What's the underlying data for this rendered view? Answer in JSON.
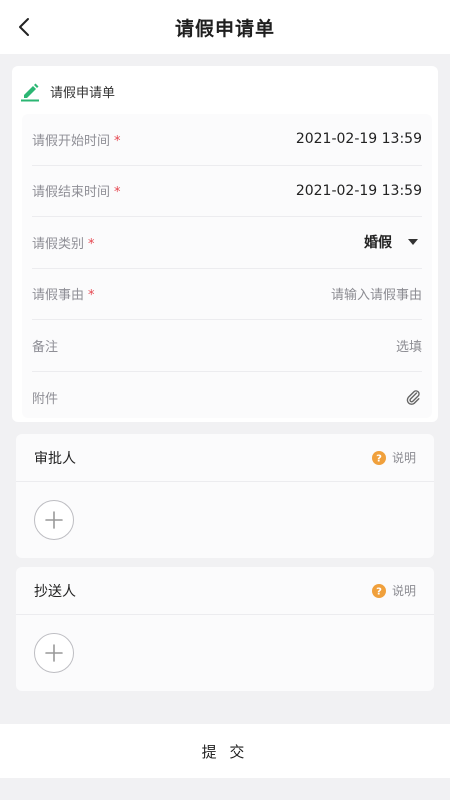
{
  "header": {
    "title": "请假申请单",
    "back_icon": "chevron-left-icon"
  },
  "form": {
    "section_title": "请假申请单",
    "section_icon": "pen-icon",
    "accent_color": "#2bb673",
    "required_mark": "*",
    "required_color": "#e5454f",
    "fields": [
      {
        "label": "请假开始时间",
        "required": true,
        "value": "2021-02-19 13:59"
      },
      {
        "label": "请假结束时间",
        "required": true,
        "value": "2021-02-19 13:59"
      },
      {
        "label": "请假类别",
        "required": true,
        "value": "婚假"
      },
      {
        "label": "请假事由",
        "required": true,
        "placeholder": "请输入请假事由"
      },
      {
        "label": "备注",
        "required": false,
        "placeholder": "选填"
      },
      {
        "label": "附件",
        "required": false,
        "icon": "paperclip-icon"
      }
    ]
  },
  "approvers": {
    "title": "审批人",
    "help_label": "说明",
    "help_color": "#f0a03c"
  },
  "cc": {
    "title": "抄送人",
    "help_label": "说明",
    "help_color": "#f0a03c"
  },
  "footer": {
    "submit_label": "提 交"
  }
}
